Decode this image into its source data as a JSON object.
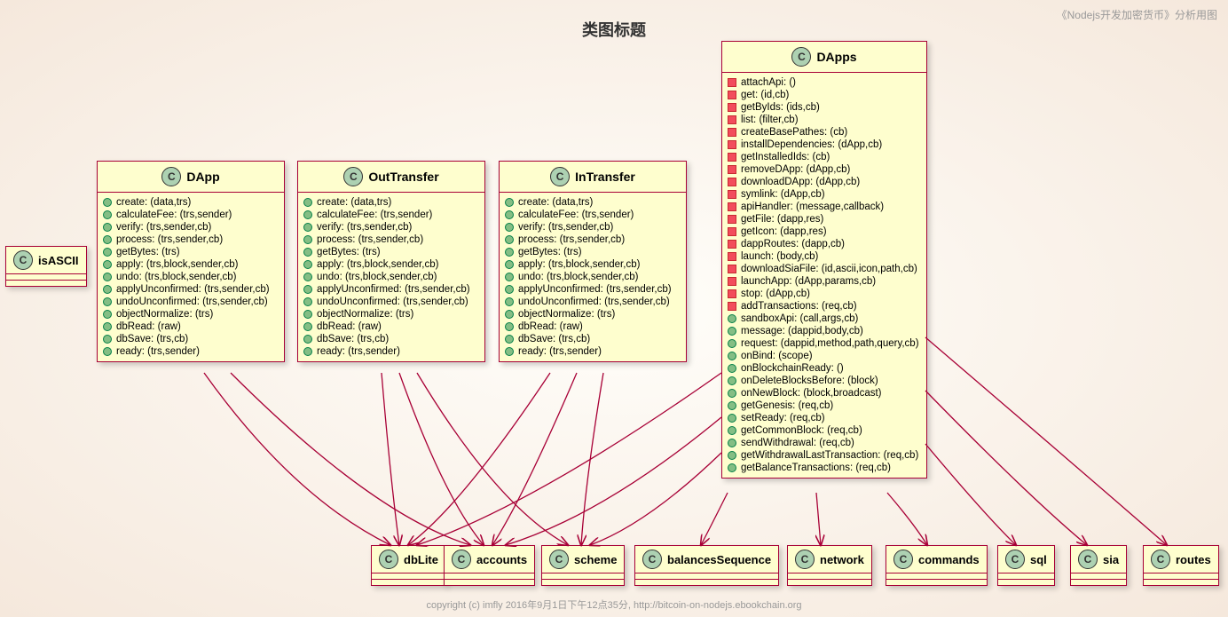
{
  "title": "类图标题",
  "watermark": "《Nodejs开发加密货币》分析用图",
  "footer": "copyright (c) imfly 2016年9月1日下午12点35分,   http://bitcoin-on-nodejs.ebookchain.org",
  "classes": {
    "isASCII": {
      "name": "isASCII"
    },
    "DApp": {
      "name": "DApp",
      "members": [
        {
          "vis": "public",
          "sig": "create: (data,trs)"
        },
        {
          "vis": "public",
          "sig": "calculateFee: (trs,sender)"
        },
        {
          "vis": "public",
          "sig": "verify: (trs,sender,cb)"
        },
        {
          "vis": "public",
          "sig": "process: (trs,sender,cb)"
        },
        {
          "vis": "public",
          "sig": "getBytes: (trs)"
        },
        {
          "vis": "public",
          "sig": "apply: (trs,block,sender,cb)"
        },
        {
          "vis": "public",
          "sig": "undo: (trs,block,sender,cb)"
        },
        {
          "vis": "public",
          "sig": "applyUnconfirmed: (trs,sender,cb)"
        },
        {
          "vis": "public",
          "sig": "undoUnconfirmed: (trs,sender,cb)"
        },
        {
          "vis": "public",
          "sig": "objectNormalize: (trs)"
        },
        {
          "vis": "public",
          "sig": "dbRead: (raw)"
        },
        {
          "vis": "public",
          "sig": "dbSave: (trs,cb)"
        },
        {
          "vis": "public",
          "sig": "ready: (trs,sender)"
        }
      ]
    },
    "OutTransfer": {
      "name": "OutTransfer",
      "members": [
        {
          "vis": "public",
          "sig": "create: (data,trs)"
        },
        {
          "vis": "public",
          "sig": "calculateFee: (trs,sender)"
        },
        {
          "vis": "public",
          "sig": "verify: (trs,sender,cb)"
        },
        {
          "vis": "public",
          "sig": "process: (trs,sender,cb)"
        },
        {
          "vis": "public",
          "sig": "getBytes: (trs)"
        },
        {
          "vis": "public",
          "sig": "apply: (trs,block,sender,cb)"
        },
        {
          "vis": "public",
          "sig": "undo: (trs,block,sender,cb)"
        },
        {
          "vis": "public",
          "sig": "applyUnconfirmed: (trs,sender,cb)"
        },
        {
          "vis": "public",
          "sig": "undoUnconfirmed: (trs,sender,cb)"
        },
        {
          "vis": "public",
          "sig": "objectNormalize: (trs)"
        },
        {
          "vis": "public",
          "sig": "dbRead: (raw)"
        },
        {
          "vis": "public",
          "sig": "dbSave: (trs,cb)"
        },
        {
          "vis": "public",
          "sig": "ready: (trs,sender)"
        }
      ]
    },
    "InTransfer": {
      "name": "InTransfer",
      "members": [
        {
          "vis": "public",
          "sig": "create: (data,trs)"
        },
        {
          "vis": "public",
          "sig": "calculateFee: (trs,sender)"
        },
        {
          "vis": "public",
          "sig": "verify: (trs,sender,cb)"
        },
        {
          "vis": "public",
          "sig": "process: (trs,sender,cb)"
        },
        {
          "vis": "public",
          "sig": "getBytes: (trs)"
        },
        {
          "vis": "public",
          "sig": "apply: (trs,block,sender,cb)"
        },
        {
          "vis": "public",
          "sig": "undo: (trs,block,sender,cb)"
        },
        {
          "vis": "public",
          "sig": "applyUnconfirmed: (trs,sender,cb)"
        },
        {
          "vis": "public",
          "sig": "undoUnconfirmed: (trs,sender,cb)"
        },
        {
          "vis": "public",
          "sig": "objectNormalize: (trs)"
        },
        {
          "vis": "public",
          "sig": "dbRead: (raw)"
        },
        {
          "vis": "public",
          "sig": "dbSave: (trs,cb)"
        },
        {
          "vis": "public",
          "sig": "ready: (trs,sender)"
        }
      ]
    },
    "DApps": {
      "name": "DApps",
      "members": [
        {
          "vis": "private",
          "sig": "attachApi: ()"
        },
        {
          "vis": "private",
          "sig": "get: (id,cb)"
        },
        {
          "vis": "private",
          "sig": "getByIds: (ids,cb)"
        },
        {
          "vis": "private",
          "sig": "list: (filter,cb)"
        },
        {
          "vis": "private",
          "sig": "createBasePathes: (cb)"
        },
        {
          "vis": "private",
          "sig": "installDependencies: (dApp,cb)"
        },
        {
          "vis": "private",
          "sig": "getInstalledIds: (cb)"
        },
        {
          "vis": "private",
          "sig": "removeDApp: (dApp,cb)"
        },
        {
          "vis": "private",
          "sig": "downloadDApp: (dApp,cb)"
        },
        {
          "vis": "private",
          "sig": "symlink: (dApp,cb)"
        },
        {
          "vis": "private",
          "sig": "apiHandler: (message,callback)"
        },
        {
          "vis": "private",
          "sig": "getFile: (dapp,res)"
        },
        {
          "vis": "private",
          "sig": "getIcon: (dapp,res)"
        },
        {
          "vis": "private",
          "sig": "dappRoutes: (dapp,cb)"
        },
        {
          "vis": "private",
          "sig": "launch: (body,cb)"
        },
        {
          "vis": "private",
          "sig": "downloadSiaFile: (id,ascii,icon,path,cb)"
        },
        {
          "vis": "private",
          "sig": "launchApp: (dApp,params,cb)"
        },
        {
          "vis": "private",
          "sig": "stop: (dApp,cb)"
        },
        {
          "vis": "private",
          "sig": "addTransactions: (req,cb)"
        },
        {
          "vis": "public",
          "sig": "sandboxApi: (call,args,cb)"
        },
        {
          "vis": "public",
          "sig": "message: (dappid,body,cb)"
        },
        {
          "vis": "public",
          "sig": "request: (dappid,method,path,query,cb)"
        },
        {
          "vis": "public",
          "sig": "onBind: (scope)"
        },
        {
          "vis": "public",
          "sig": "onBlockchainReady: ()"
        },
        {
          "vis": "public",
          "sig": "onDeleteBlocksBefore: (block)"
        },
        {
          "vis": "public",
          "sig": "onNewBlock: (block,broadcast)"
        },
        {
          "vis": "public",
          "sig": "getGenesis: (req,cb)"
        },
        {
          "vis": "public",
          "sig": "setReady: (req,cb)"
        },
        {
          "vis": "public",
          "sig": "getCommonBlock: (req,cb)"
        },
        {
          "vis": "public",
          "sig": "sendWithdrawal: (req,cb)"
        },
        {
          "vis": "public",
          "sig": "getWithdrawalLastTransaction: (req,cb)"
        },
        {
          "vis": "public",
          "sig": "getBalanceTransactions: (req,cb)"
        }
      ]
    }
  },
  "targets": {
    "dbLite": "dbLite",
    "accounts": "accounts",
    "scheme": "scheme",
    "balancesSequence": "balancesSequence",
    "network": "network",
    "commands": "commands",
    "sql": "sql",
    "sia": "sia",
    "routes": "routes"
  }
}
